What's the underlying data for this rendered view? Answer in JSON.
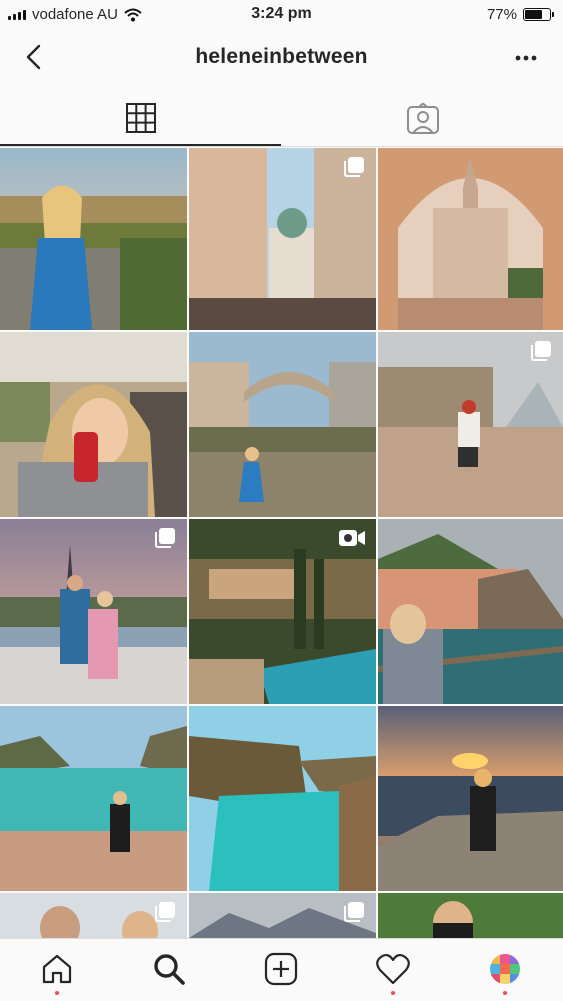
{
  "status_bar": {
    "carrier": "vodafone AU",
    "time": "3:24 pm",
    "battery_percent": "77%",
    "battery_level": 0.77
  },
  "header": {
    "username": "heleneinbetween"
  },
  "tabs": [
    {
      "icon": "grid-icon",
      "active": true
    },
    {
      "icon": "tagged-person-icon",
      "active": false
    }
  ],
  "grid_badges": [
    "carousel-icon",
    "reel-video-icon"
  ],
  "bottom_nav": [
    {
      "icon": "home-icon",
      "notify": true
    },
    {
      "icon": "search-icon",
      "notify": false
    },
    {
      "icon": "new-post-icon",
      "notify": false
    },
    {
      "icon": "heart-icon",
      "notify": true
    },
    {
      "icon": "profile-avatar-icon",
      "notify": true
    }
  ],
  "colors": {
    "accent_dot": "#ed4956",
    "text": "#262626",
    "border": "#dbdbdb"
  }
}
